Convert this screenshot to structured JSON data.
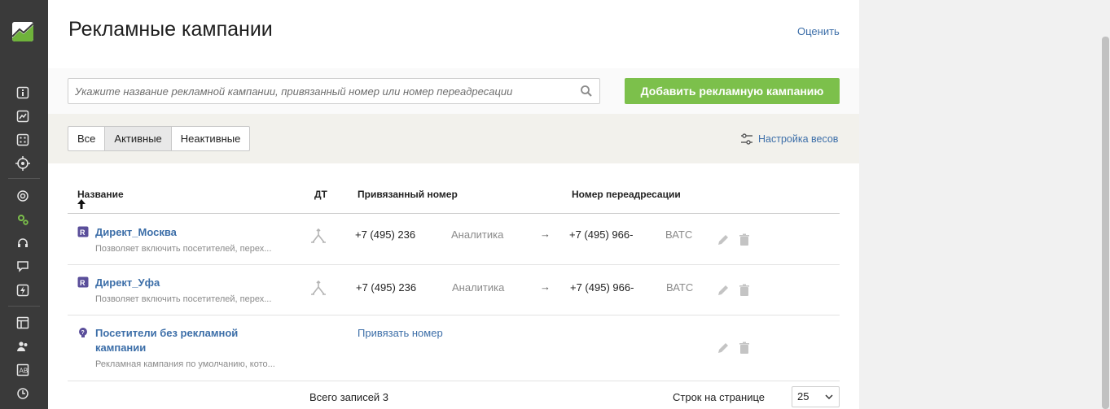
{
  "page": {
    "title": "Рекламные кампании",
    "rate_link": "Оценить"
  },
  "search": {
    "placeholder": "Укажите название рекламной кампании, привязанный номер или номер переадресации",
    "add_button": "Добавить рекламную кампанию"
  },
  "filters": {
    "tabs": [
      "Все",
      "Активные",
      "Неактивные"
    ],
    "active_tab": "Активные",
    "weights_link": "Настройка весов"
  },
  "table": {
    "headers": {
      "name": "Название",
      "dt": "ДТ",
      "bound_number": "Привязанный номер",
      "redirect_number": "Номер переадресации"
    },
    "rows": [
      {
        "name": "Директ_Москва",
        "description": "Позволяет включить посетителей, перех...",
        "bound_number": "+7 (495) 236",
        "bound_type": "Аналитика",
        "arrow": "→",
        "redirect_number": "+7 (495) 966-",
        "redirect_type": "ВАТС"
      },
      {
        "name": "Директ_Уфа",
        "description": "Позволяет включить посетителей, перех...",
        "bound_number": "+7 (495) 236",
        "bound_type": "Аналитика",
        "arrow": "→",
        "redirect_number": "+7 (495) 966-",
        "redirect_type": "ВАТС"
      },
      {
        "name_line1": "Посетители без рекламной",
        "name_line2": "кампании",
        "description": "Рекламная кампания по умолчанию, кото...",
        "bind_link": "Привязать номер"
      }
    ]
  },
  "footer": {
    "total": "Всего записей 3",
    "rows_per_page_label": "Строк на странице",
    "rows_per_page_value": "25"
  },
  "colors": {
    "sidebar": "#3a3a3a",
    "accent_green": "#7cc04b",
    "link_blue": "#3c6ea8",
    "filter_band": "#f2f1ec"
  },
  "icons": {
    "sidebar": [
      "info-icon",
      "chart-icon",
      "calculator-icon",
      "target-icon",
      "speaker-icon",
      "gear-icon",
      "headset-icon",
      "chat-icon",
      "lightning-icon",
      "table-icon",
      "users-icon",
      "ab-icon",
      "clock-icon"
    ]
  }
}
